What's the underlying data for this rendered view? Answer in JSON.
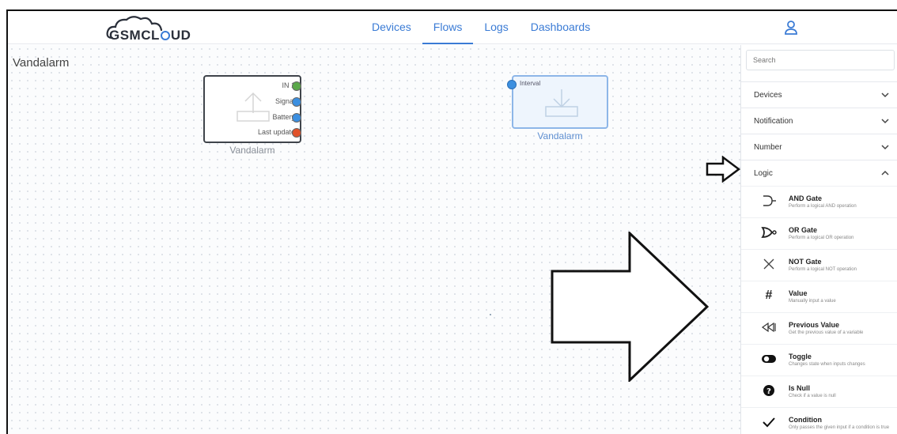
{
  "header": {
    "logo_text_a": "GSM",
    "logo_text_b": "CL",
    "logo_text_c": "UD",
    "nav": [
      {
        "label": "Devices",
        "active": false
      },
      {
        "label": "Flows",
        "active": true
      },
      {
        "label": "Logs",
        "active": false
      },
      {
        "label": "Dashboards",
        "active": false
      }
    ],
    "user_icon": "user-icon"
  },
  "canvas": {
    "flow_title": "Vandalarm",
    "node1": {
      "caption": "Vandalarm",
      "icon": "upload-icon",
      "ports": [
        {
          "label": "IN 1",
          "color": "#5ba84a"
        },
        {
          "label": "Signal",
          "color": "#3b8fe0"
        },
        {
          "label": "Battery",
          "color": "#3b8fe0"
        },
        {
          "label": "Last update",
          "color": "#e0522a"
        }
      ]
    },
    "node2": {
      "caption": "Vandalarm",
      "icon": "download-icon",
      "input_port": {
        "label": "Interval",
        "color": "#3b8fe0"
      }
    }
  },
  "sidebar": {
    "search_placeholder": "Search",
    "categories": [
      {
        "label": "Devices",
        "expanded": false
      },
      {
        "label": "Notification",
        "expanded": false
      },
      {
        "label": "Number",
        "expanded": false
      },
      {
        "label": "Logic",
        "expanded": true
      }
    ],
    "logic_items": [
      {
        "title": "AND Gate",
        "desc": "Perform a logical AND operation",
        "icon": "and-gate-icon"
      },
      {
        "title": "OR Gate",
        "desc": "Perform a logical OR operation",
        "icon": "or-gate-icon"
      },
      {
        "title": "NOT Gate",
        "desc": "Perform a logical NOT operation",
        "icon": "not-gate-icon"
      },
      {
        "title": "Value",
        "desc": "Manually input a value",
        "icon": "hash-icon"
      },
      {
        "title": "Previous Value",
        "desc": "Get the previous value of a variable",
        "icon": "rewind-icon"
      },
      {
        "title": "Toggle",
        "desc": "Changes state when inputs changes",
        "icon": "toggle-icon"
      },
      {
        "title": "Is Null",
        "desc": "Check if a value is null",
        "icon": "question-icon"
      },
      {
        "title": "Condition",
        "desc": "Only passes the given input if a condition is true",
        "icon": "check-icon"
      }
    ]
  },
  "annotations": {
    "small_arrow": "arrow-right-icon",
    "big_arrow": "arrow-right-icon"
  }
}
